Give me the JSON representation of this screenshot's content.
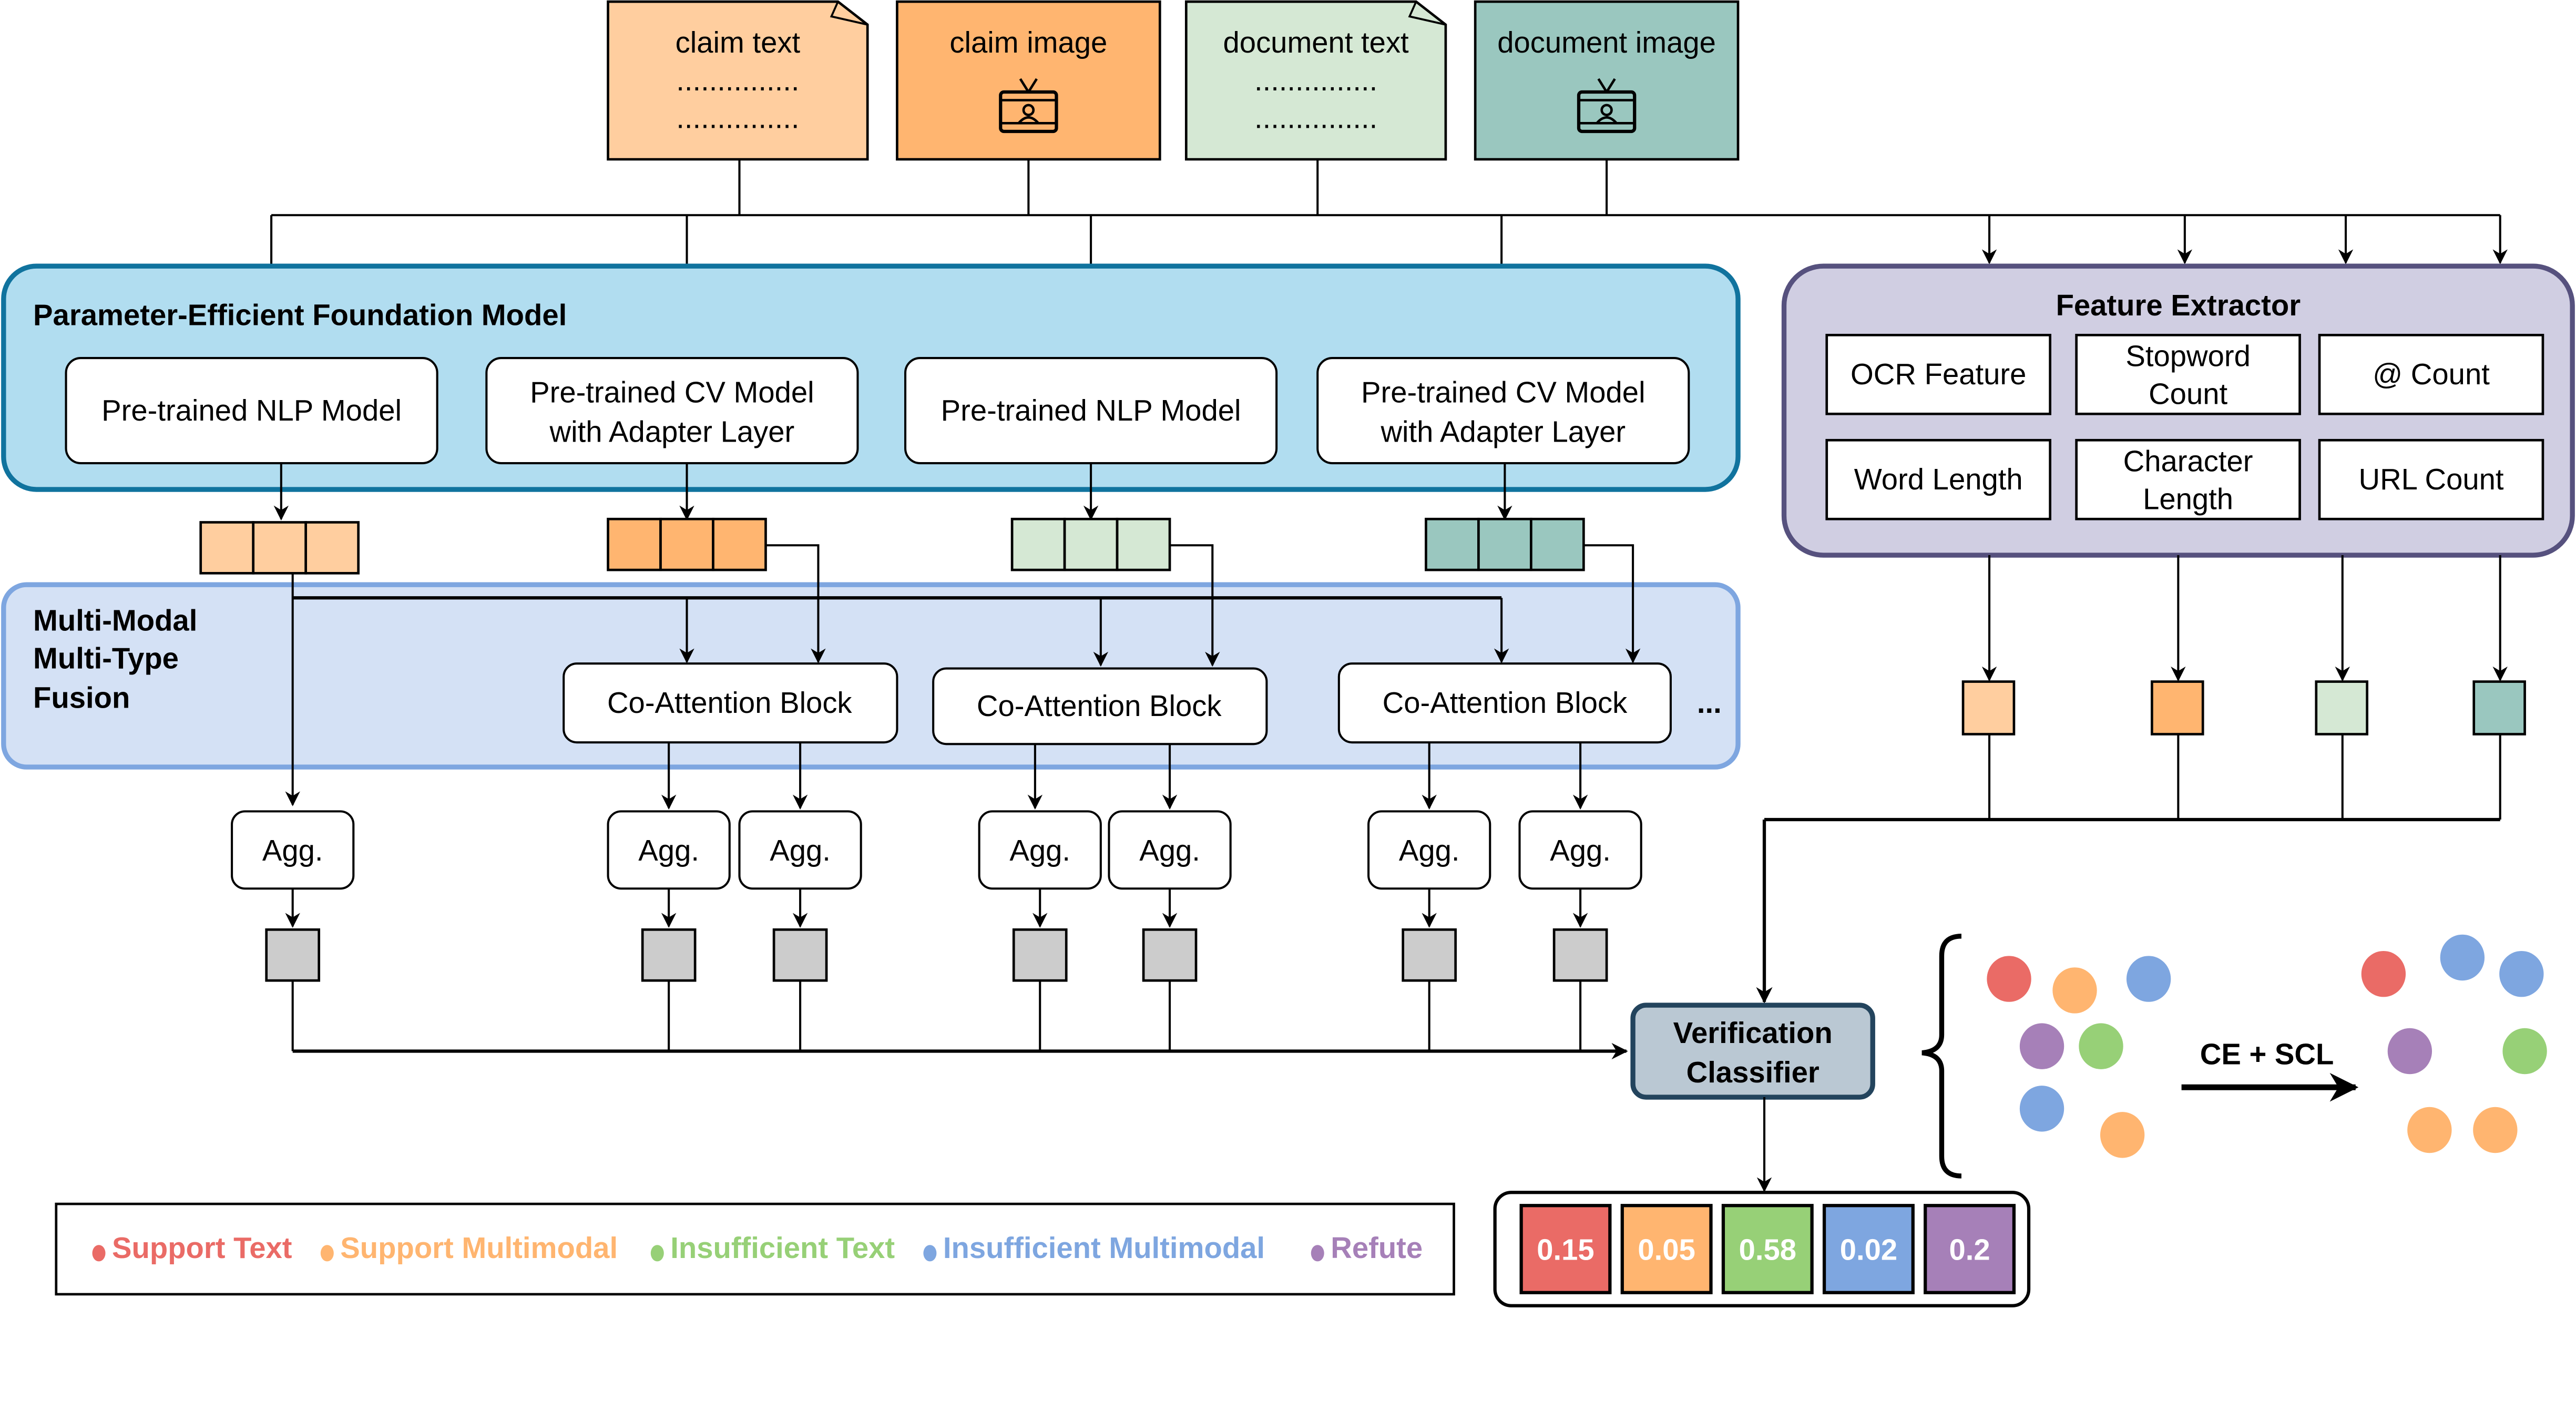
{
  "inputs": [
    {
      "label": "claim text",
      "kind": "text",
      "color": "#FFCE9F"
    },
    {
      "label": "claim image",
      "kind": "image",
      "color": "#FFB570"
    },
    {
      "label": "document text",
      "kind": "text",
      "color": "#D5E8D4"
    },
    {
      "label": "document image",
      "kind": "image",
      "color": "#9AC7BF"
    }
  ],
  "dots_text": "...............",
  "foundation": {
    "title": "Parameter-Efficient  Foundation Model",
    "models": [
      {
        "line1": "Pre-trained NLP Model",
        "line2": ""
      },
      {
        "line1": "Pre-trained CV Model",
        "line2": "with Adapter Layer"
      },
      {
        "line1": "Pre-trained NLP Model",
        "line2": ""
      },
      {
        "line1": "Pre-trained CV Model",
        "line2": "with Adapter Layer"
      }
    ]
  },
  "fusion": {
    "title_lines": [
      "Multi-Modal",
      "Multi-Type",
      "Fusion"
    ],
    "blocks": [
      "Co-Attention Block",
      "Co-Attention Block",
      "Co-Attention Block"
    ],
    "ellipsis": "..."
  },
  "agg_label": "Agg.",
  "feature_extractor": {
    "title": "Feature Extractor",
    "features": [
      {
        "line1": "OCR Feature",
        "line2": ""
      },
      {
        "line1": "Stopword",
        "line2": "Count"
      },
      {
        "line1": "@ Count",
        "line2": ""
      },
      {
        "line1": "Word Length",
        "line2": ""
      },
      {
        "line1": "Character",
        "line2": "Length"
      },
      {
        "line1": "URL Count",
        "line2": ""
      }
    ]
  },
  "classifier": {
    "line1": "Verification",
    "line2": "Classifier"
  },
  "loss_label": "CE + SCL",
  "classes": [
    {
      "name": "Support Text",
      "color": "#EA6B66",
      "prob": "0.15"
    },
    {
      "name": "Support Multimodal",
      "color": "#FFB570",
      "prob": "0.05"
    },
    {
      "name": "Insufficient Text",
      "color": "#97D077",
      "prob": "0.58"
    },
    {
      "name": "Insufficient Multimodal",
      "color": "#7EA6E0",
      "prob": "0.02"
    },
    {
      "name": "Refute",
      "color": "#A680B8",
      "prob": "0.2"
    }
  ],
  "colors": {
    "foundation_fill": "#B1DDF0",
    "foundation_stroke": "#10739E",
    "fusion_fill": "#D4E1F5",
    "fusion_stroke": "#7EA6E0",
    "extractor_fill": "#D0CEE2",
    "extractor_stroke": "#56517E",
    "classifier_fill": "#BAC8D3",
    "classifier_stroke": "#23445D",
    "agg_vec_fill": "#CCCCCC"
  }
}
